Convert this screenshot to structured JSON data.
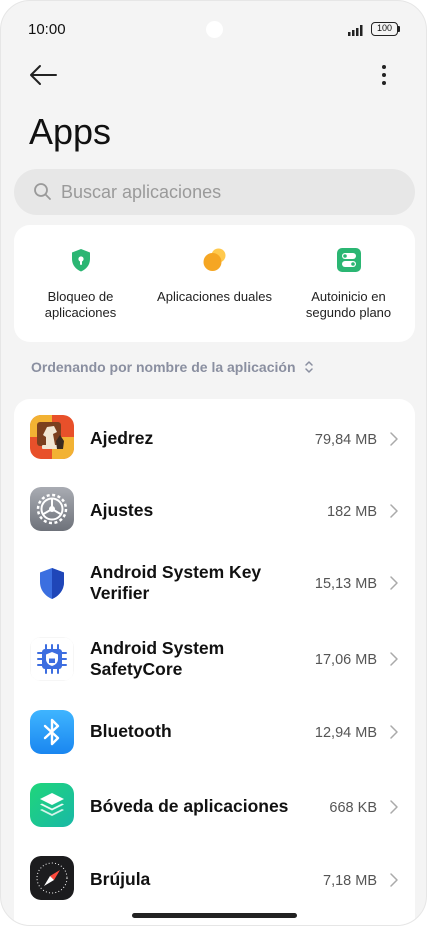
{
  "status_bar": {
    "time": "10:00",
    "battery": "100"
  },
  "header": {
    "back_icon": "arrow-left-icon",
    "more_icon": "more-vertical-icon",
    "title": "Apps"
  },
  "search": {
    "placeholder": "Buscar aplicaciones",
    "value": ""
  },
  "quick_actions": [
    {
      "label": "Bloqueo de aplicaciones",
      "icon": "shield-lock-icon",
      "color": "#2bb673"
    },
    {
      "label": "Aplicaciones duales",
      "icon": "dual-circles-icon",
      "color": "#f5a623"
    },
    {
      "label": "Autoinicio en segundo plano",
      "icon": "toggle-switches-icon",
      "color": "#2bb673"
    }
  ],
  "sort": {
    "label": "Ordenando por nombre de la aplicación"
  },
  "apps": [
    {
      "name": "Ajedrez",
      "size": "79,84 MB",
      "icon": "chess-icon"
    },
    {
      "name": "Ajustes",
      "size": "182 MB",
      "icon": "gear-icon"
    },
    {
      "name": "Android System Key Verifier",
      "size": "15,13 MB",
      "icon": "shield-icon"
    },
    {
      "name": "Android System SafetyCore",
      "size": "17,06 MB",
      "icon": "safetycore-chip-icon"
    },
    {
      "name": "Bluetooth",
      "size": "12,94 MB",
      "icon": "bluetooth-icon"
    },
    {
      "name": "Bóveda de aplicaciones",
      "size": "668 KB",
      "icon": "layers-icon"
    },
    {
      "name": "Brújula",
      "size": "7,18 MB",
      "icon": "compass-icon"
    }
  ]
}
